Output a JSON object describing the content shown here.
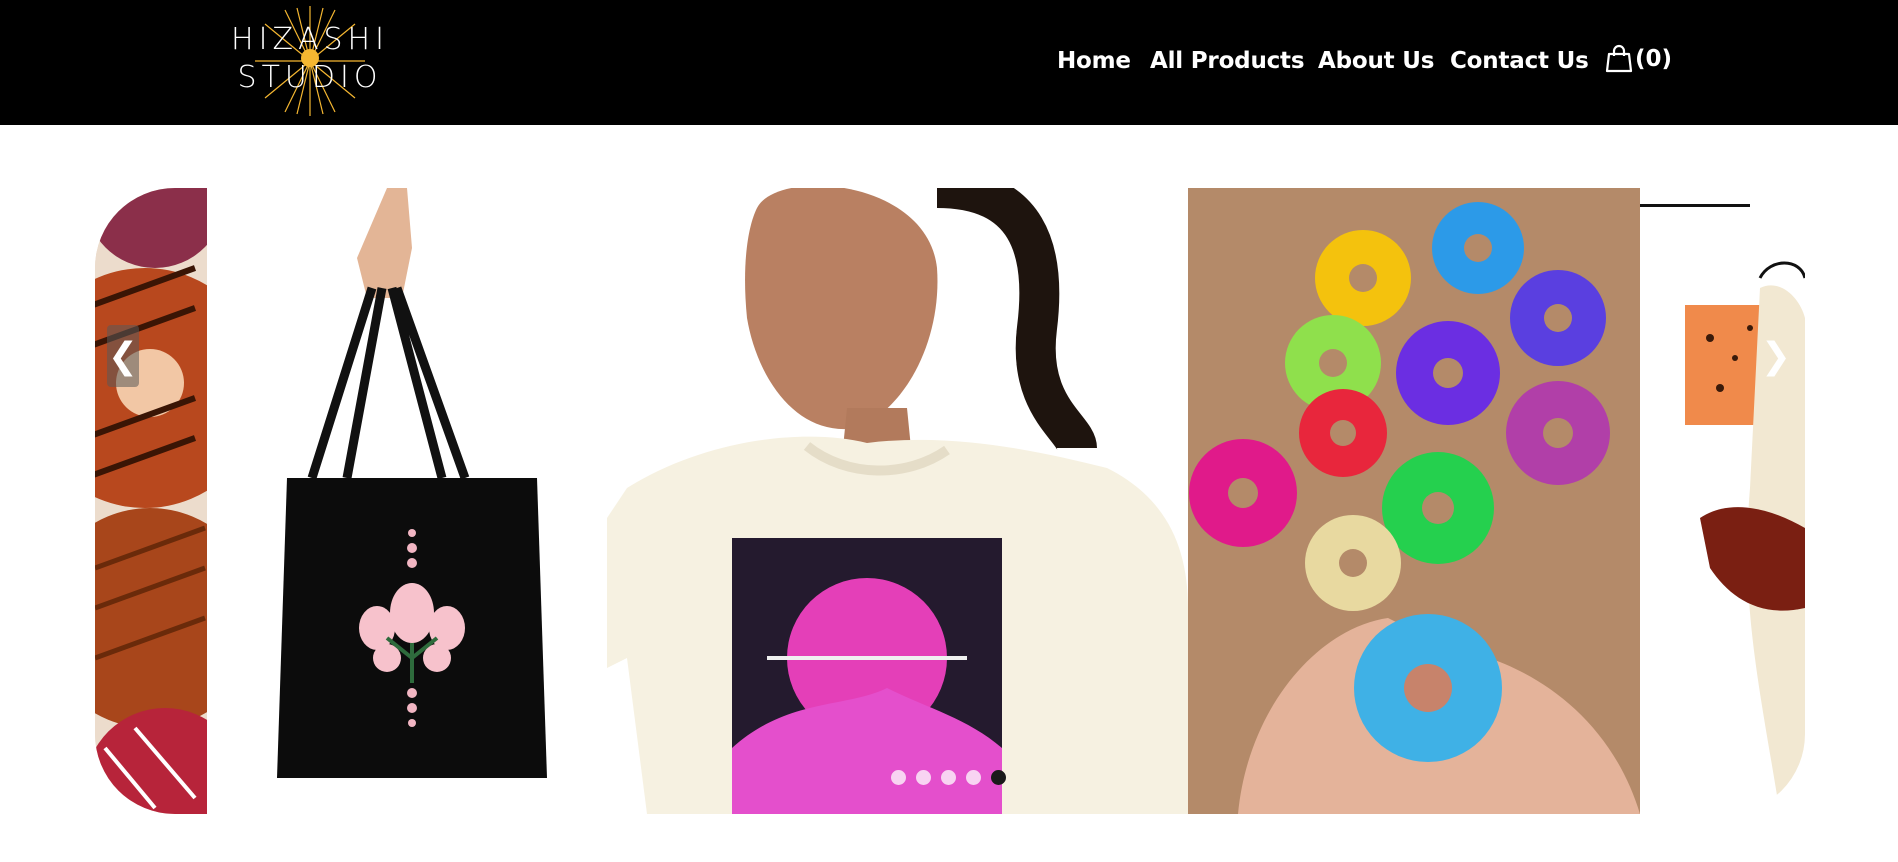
{
  "brand": {
    "logo_line1": "HIZASHI",
    "logo_line2": "STUDIO",
    "accent_color": "#f5b731"
  },
  "nav": {
    "items": [
      {
        "label": "Home"
      },
      {
        "label": "All Products"
      },
      {
        "label": "About Us"
      },
      {
        "label": "Contact Us"
      }
    ],
    "cart": {
      "icon": "shopping-bag-icon",
      "count_label": "(0)"
    }
  },
  "carousel": {
    "prev_label": "❮",
    "next_label": "❯",
    "slide_count": 5,
    "active_slide": 5
  }
}
